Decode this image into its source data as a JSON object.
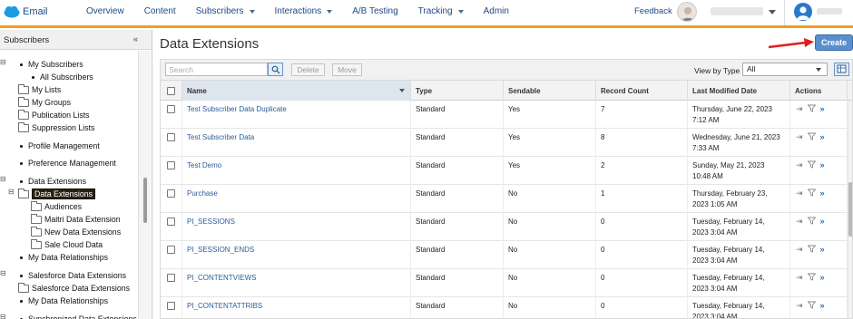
{
  "topnav": {
    "app_name": "Email",
    "items": [
      {
        "label": "Overview",
        "dropdown": false
      },
      {
        "label": "Content",
        "dropdown": false
      },
      {
        "label": "Subscribers",
        "dropdown": true
      },
      {
        "label": "Interactions",
        "dropdown": true
      },
      {
        "label": "A/B Testing",
        "dropdown": false
      },
      {
        "label": "Tracking",
        "dropdown": true
      },
      {
        "label": "Admin",
        "dropdown": false
      }
    ],
    "feedback_label": "Feedback",
    "accent_color": "#f49c1b",
    "link_color": "#1e4a82"
  },
  "sidebar": {
    "title": "Subscribers",
    "collapse_icon": "«",
    "tree": [
      {
        "label": "My Subscribers",
        "kind": "bullet",
        "toggle": "⊟"
      },
      {
        "label": "All Subscribers",
        "kind": "bullet"
      },
      {
        "label": "My Lists",
        "kind": "folder"
      },
      {
        "label": "My Groups",
        "kind": "folder"
      },
      {
        "label": "Publication Lists",
        "kind": "folder"
      },
      {
        "label": "Suppression Lists",
        "kind": "folder"
      },
      {
        "label": "Profile Management",
        "kind": "bullet"
      },
      {
        "label": "Preference Management",
        "kind": "bullet"
      },
      {
        "label": "Data Extensions",
        "kind": "bullet",
        "toggle": "⊟"
      },
      {
        "label": "Data Extensions",
        "kind": "folder",
        "selected": true,
        "toggle": "⊟"
      },
      {
        "label": "Audiences",
        "kind": "folder"
      },
      {
        "label": "Maitri Data Extension",
        "kind": "folder"
      },
      {
        "label": "New Data Extensions",
        "kind": "folder"
      },
      {
        "label": "Sale Cloud Data",
        "kind": "folder"
      },
      {
        "label": "My Data Relationships",
        "kind": "bullet"
      },
      {
        "label": "Salesforce Data Extensions",
        "kind": "bullet",
        "toggle": "⊟"
      },
      {
        "label": "Salesforce Data Extensions",
        "kind": "folder"
      },
      {
        "label": "My Data Relationships",
        "kind": "bullet"
      },
      {
        "label": "Synchronized Data Extensions",
        "kind": "bullet",
        "toggle": "⊟"
      }
    ]
  },
  "main": {
    "title": "Data Extensions",
    "create_label": "Create",
    "toolbar": {
      "search_placeholder": "Search",
      "delete_label": "Delete",
      "move_label": "Move",
      "view_by_label": "View by Type",
      "view_by_value": "All"
    },
    "columns": [
      "Name",
      "Type",
      "Sendable",
      "Record Count",
      "Last Modified Date",
      "Actions"
    ],
    "rows": [
      {
        "name": "Test Subscriber Data Duplicate",
        "type": "Standard",
        "sendable": "Yes",
        "count": "7",
        "date1": "Thursday, June 22, 2023",
        "date2": "7:12 AM"
      },
      {
        "name": "Test Subscriber Data",
        "type": "Standard",
        "sendable": "Yes",
        "count": "8",
        "date1": "Wednesday, June 21, 2023",
        "date2": "7:33 AM"
      },
      {
        "name": "Test Demo",
        "type": "Standard",
        "sendable": "Yes",
        "count": "2",
        "date1": "Sunday, May 21, 2023",
        "date2": "10:48 AM"
      },
      {
        "name": "Purchase",
        "type": "Standard",
        "sendable": "No",
        "count": "1",
        "date1": "Thursday, February 23,",
        "date2": "2023 1:05 AM"
      },
      {
        "name": "PI_SESSIONS",
        "type": "Standard",
        "sendable": "No",
        "count": "0",
        "date1": "Tuesday, February 14,",
        "date2": "2023 3:04 AM"
      },
      {
        "name": "PI_SESSION_ENDS",
        "type": "Standard",
        "sendable": "No",
        "count": "0",
        "date1": "Tuesday, February 14,",
        "date2": "2023 3:04 AM"
      },
      {
        "name": "PI_CONTENTVIEWS",
        "type": "Standard",
        "sendable": "No",
        "count": "0",
        "date1": "Tuesday, February 14,",
        "date2": "2023 3:04 AM"
      },
      {
        "name": "PI_CONTENTATTRIBS",
        "type": "Standard",
        "sendable": "No",
        "count": "0",
        "date1": "Tuesday, February 14,",
        "date2": "2023 3:04 AM"
      }
    ],
    "action_icons": [
      "import-icon",
      "filter-icon",
      "more-icon"
    ]
  }
}
